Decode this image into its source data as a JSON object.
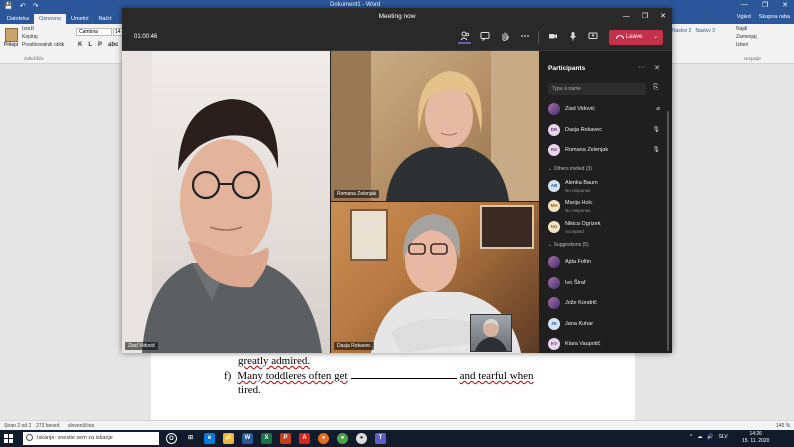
{
  "word": {
    "quick_access": [
      "💾",
      "↶",
      "↷"
    ],
    "title": "Dokument1 - Word",
    "window_controls": [
      "—",
      "❐",
      "✕"
    ],
    "tabs": [
      "Datoteka",
      "Osnovno",
      "Umetni",
      "Načrt",
      "Post"
    ],
    "tabs_right": [
      "Vgled",
      "Skupna raba"
    ],
    "ribbon": {
      "paste_label": "Prilepi",
      "clipboard_items": [
        "Izreži",
        "Kopiraj",
        "Preslikovalnik oblik"
      ],
      "clipboard_group": "Odložišče",
      "font_name": "Cambria",
      "font_size": "14",
      "format_buttons": [
        "K",
        "L",
        "P",
        "abc"
      ],
      "styles": [
        "Naslov 2",
        "Naslov 3"
      ],
      "edit_items": [
        "Najdi",
        "Zamenjaj",
        "Izberi"
      ],
      "edit_group": "Urejanje"
    },
    "document": {
      "line1": "greatly admired.",
      "line2_label": "f)",
      "line2_start": "Many toddleres often get",
      "line2_end": "and tearful when",
      "line3": "tired."
    },
    "status": {
      "page": "Stran 2 od 2",
      "words": "273 besed",
      "lang": "slovenščina",
      "zoom": "140 %"
    }
  },
  "taskbar": {
    "search_placeholder": "Iskanje: vnesite sem za iskanje",
    "apps": [
      "O",
      "⊞",
      "e",
      "📁",
      "W",
      "X",
      "P",
      "A",
      "●",
      "●",
      "●",
      "T"
    ],
    "tray": [
      "^",
      "☁",
      "🔊",
      "SLV"
    ],
    "time": "14:26",
    "date": "15. 11. 2020"
  },
  "teams": {
    "window_title": "Meeting now",
    "window_controls": [
      "—",
      "❐",
      "✕"
    ],
    "timer": "01:00:46",
    "toolbar_icons": [
      "participants-icon",
      "chat-icon",
      "raise-hand-icon",
      "more-icon",
      "camera-icon",
      "mic-icon",
      "share-icon"
    ],
    "leave_label": "Leave",
    "tiles": [
      {
        "name": "Ziad Vidović"
      },
      {
        "name": "Romana Zelenjak"
      },
      {
        "name": "Dasja Rokavec"
      }
    ],
    "panel": {
      "title": "Participants",
      "search_placeholder": "Type a name",
      "in_meeting": [
        {
          "initials": "ZV",
          "name": "Ziad Vidović"
        },
        {
          "initials": "DR",
          "name": "Dasja Rokavec"
        },
        {
          "initials": "RZ",
          "name": "Romana Zelenjak"
        }
      ],
      "others_header": "Others invited (3)",
      "others": [
        {
          "initials": "AB",
          "name": "Alenka Baum",
          "status": "No response"
        },
        {
          "initials": "MH",
          "name": "Marija Holc",
          "status": "No response"
        },
        {
          "initials": "NO",
          "name": "Nikica Ogrizek",
          "status": "Accepted"
        }
      ],
      "suggestions_header": "Suggestions (5)",
      "suggestions": [
        {
          "initials": "AF",
          "name": "Ajda Foltin"
        },
        {
          "initials": "IS",
          "name": "Ivo Štraf"
        },
        {
          "initials": "JK",
          "name": "Jože Kondrič"
        },
        {
          "initials": "JK",
          "name": "Jana Kuhar"
        },
        {
          "initials": "KV",
          "name": "Klara Vaupotič"
        }
      ]
    }
  }
}
